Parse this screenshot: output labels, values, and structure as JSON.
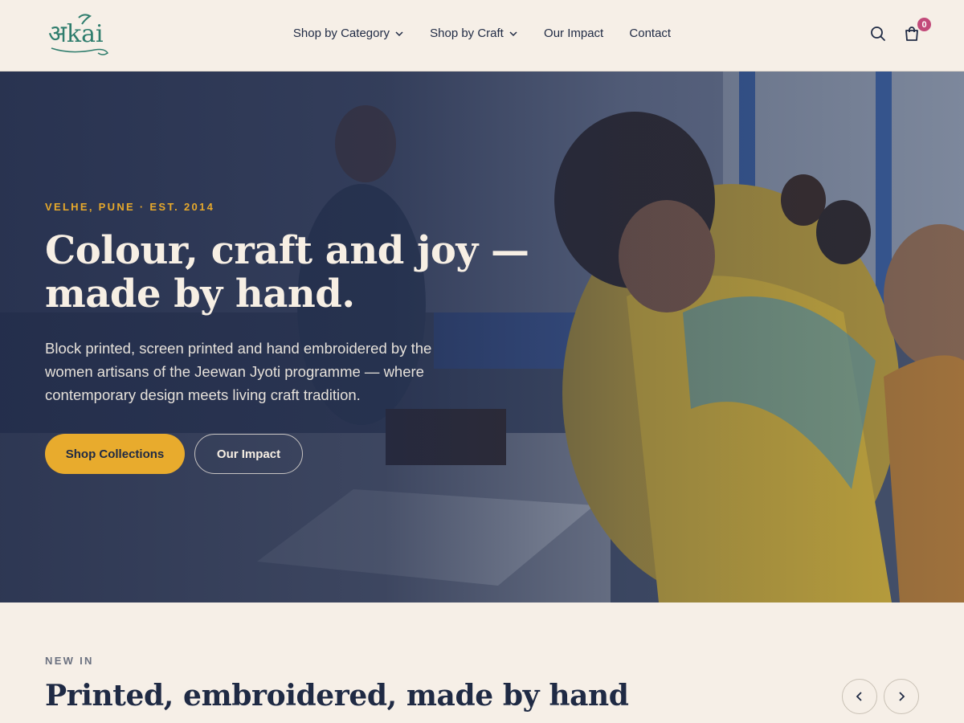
{
  "brand": {
    "logo_text": "अkai",
    "accent_color": "#2f7d6d"
  },
  "nav": {
    "items": [
      {
        "label": "Shop by Category",
        "has_dropdown": true
      },
      {
        "label": "Shop by Craft",
        "has_dropdown": true
      },
      {
        "label": "Our Impact",
        "has_dropdown": false
      },
      {
        "label": "Contact",
        "has_dropdown": false
      }
    ]
  },
  "header_icons": {
    "search": "search-icon",
    "cart": "cart-icon",
    "cart_count": "0"
  },
  "hero": {
    "eyebrow": "VELHE, PUNE · EST. 2014",
    "title": "Colour, craft and joy — made by hand.",
    "description": "Block printed, screen printed and hand embroidered by the women artisans of the Jeewan Jyoti programme — where contemporary design meets living craft tradition.",
    "primary_button": "Shop Collections",
    "secondary_button": "Our Impact"
  },
  "new_in": {
    "eyebrow": "NEW IN",
    "title": "Printed, embroidered, made by hand"
  },
  "colors": {
    "primary_button": "#e8ab2d",
    "badge": "#c24a7a",
    "eyebrow": "#e7a92b",
    "text_dark": "#1f2a44",
    "background": "#f6efe7"
  }
}
